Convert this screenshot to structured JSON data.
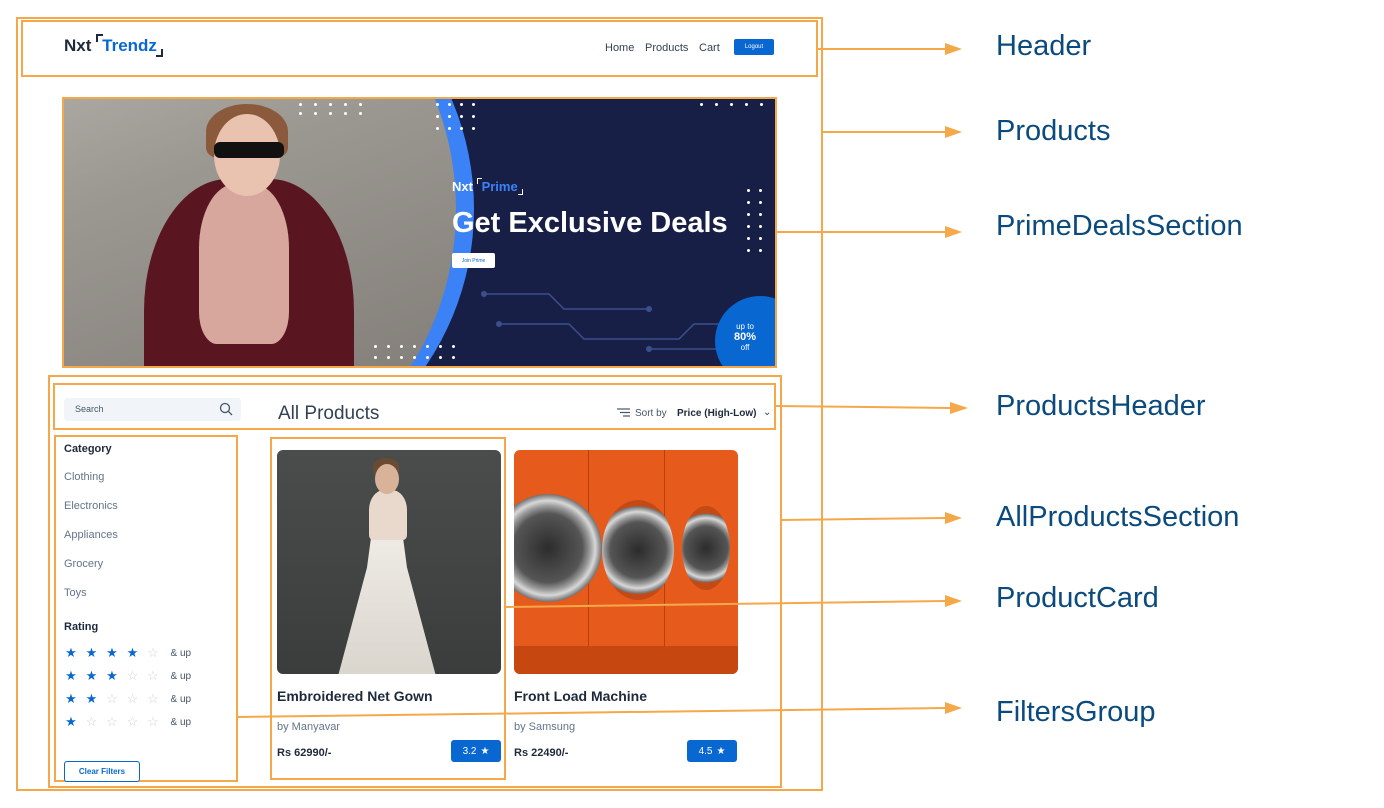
{
  "header": {
    "logo_prefix": "Nxt",
    "logo_brand": "Trendz",
    "nav": [
      "Home",
      "Products",
      "Cart"
    ],
    "logout_label": "Logout"
  },
  "banner": {
    "prime_prefix": "Nxt",
    "prime_brand": "Prime",
    "title": "Get Exclusive Deals",
    "join_label": "Join Prime",
    "offer_line1": "up to",
    "offer_line2": "80%",
    "offer_line3": "off"
  },
  "products_header": {
    "search_placeholder": "Search",
    "title": "All Products",
    "sort_label": "Sort by",
    "sort_value": "Price (High-Low)"
  },
  "filters": {
    "category_heading": "Category",
    "categories": [
      "Clothing",
      "Electronics",
      "Appliances",
      "Grocery",
      "Toys"
    ],
    "rating_heading": "Rating",
    "ratings": [
      {
        "stars": 4,
        "label": "& up"
      },
      {
        "stars": 3,
        "label": "& up"
      },
      {
        "stars": 2,
        "label": "& up"
      },
      {
        "stars": 1,
        "label": "& up"
      }
    ],
    "clear_label": "Clear Filters"
  },
  "products": [
    {
      "title": "Embroidered Net Gown",
      "brand": "by Manyavar",
      "price": "Rs 62990/-",
      "rating": "3.2"
    },
    {
      "title": "Front Load Machine",
      "brand": "by Samsung",
      "price": "Rs 22490/-",
      "rating": "4.5"
    }
  ],
  "annotations": [
    "Header",
    "Products",
    "PrimeDealsSection",
    "ProductsHeader",
    "AllProductsSection",
    "ProductCard",
    "FiltersGroup"
  ],
  "colors": {
    "annotation_border": "#f5a84a",
    "annotation_text": "#0b4a7d",
    "primary": "#0967d2",
    "banner_bg": "#171f46"
  },
  "icons": [
    "search-icon",
    "sort-icon",
    "chevron-down-icon",
    "star-icon"
  ]
}
